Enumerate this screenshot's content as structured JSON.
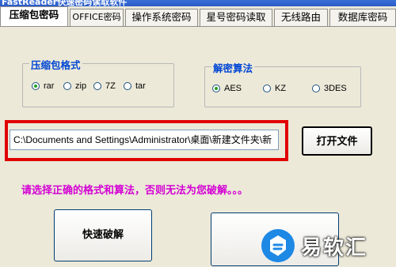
{
  "window": {
    "title": "FastReader快速密码读取软件"
  },
  "tabs": [
    {
      "label": "压缩包密码",
      "active": true
    },
    {
      "label": "OFFICE密码",
      "active": false
    },
    {
      "label": "操作系统密码",
      "active": false
    },
    {
      "label": "星号密码读取",
      "active": false
    },
    {
      "label": "无线路由",
      "active": false
    },
    {
      "label": "数据库密码",
      "active": false
    }
  ],
  "format_group": {
    "title": "压缩包格式",
    "options": [
      {
        "label": "rar",
        "selected": true
      },
      {
        "label": "zip",
        "selected": false
      },
      {
        "label": "7Z",
        "selected": false
      },
      {
        "label": "tar",
        "selected": false
      }
    ]
  },
  "algo_group": {
    "title": "解密算法",
    "options": [
      {
        "label": "AES",
        "selected": true
      },
      {
        "label": "KZ",
        "selected": false
      },
      {
        "label": "3DES",
        "selected": false
      }
    ]
  },
  "file_path": "C:\\Documents and Settings\\Administrator\\桌面\\新建文件夹\\新",
  "buttons": {
    "open_file": "打开文件",
    "quick_crack": "快速破解"
  },
  "hint": "请选择正确的格式和算法，否则无法为您破解。。。",
  "watermark": {
    "text": "易软汇"
  },
  "colors": {
    "accent": "#0046D5",
    "hint": "#D400D4",
    "highlight": "#E00000"
  }
}
